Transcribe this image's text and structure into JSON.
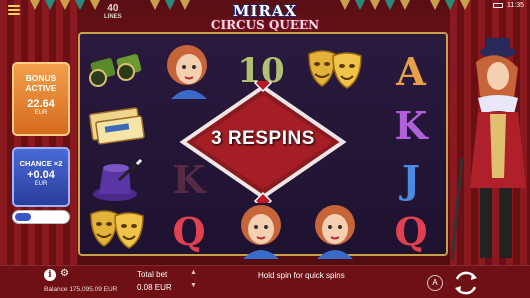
{
  "status_bar": {
    "time": "11:35"
  },
  "header": {
    "lines_number": "40",
    "lines_label": "LINES",
    "logo_top": "MIRAX",
    "logo_bottom": "CIRCUS QUEEN"
  },
  "bonus_panel": {
    "title_line1": "BONUS",
    "title_line2": "ACTIVE",
    "value": "22.64",
    "currency": "EUR"
  },
  "chance_panel": {
    "title": "CHANCE ×2",
    "value": "+0.04",
    "currency": "EUR"
  },
  "respin_banner": {
    "text": "3 RESPINS"
  },
  "reels": {
    "symbols": [
      [
        "binoculars",
        "ticket",
        "magic-hat",
        "comedy-masks"
      ],
      [
        "circus-queen",
        "ringmaster-blurred",
        "letter-k",
        "letter-q"
      ],
      [
        "letter-10",
        "wild-blurred",
        "dim",
        "circus-queen"
      ],
      [
        "comedy-masks",
        "blurred",
        "megaphone",
        "circus-queen"
      ],
      [
        "letter-a",
        "letter-k",
        "letter-j",
        "letter-q"
      ]
    ],
    "letters": {
      "r1c2": "10",
      "r1c4": "A",
      "r2c4": "K",
      "r3c1": "K",
      "r3c4": "J",
      "r4c1": "Q",
      "r4c4": "Q"
    }
  },
  "bottom_bar": {
    "balance_label": "Balance",
    "balance_value": "175,095.09 EUR",
    "total_bet_label": "Total bet",
    "total_bet_value": "0.08 EUR",
    "hint": "Hold spin for quick spins",
    "auto_label": "A"
  },
  "colors": {
    "bonus": "#e8893a",
    "chance": "#3a56c8",
    "reel_bg": "#2a1a3e",
    "frame": "#c9a04a"
  }
}
